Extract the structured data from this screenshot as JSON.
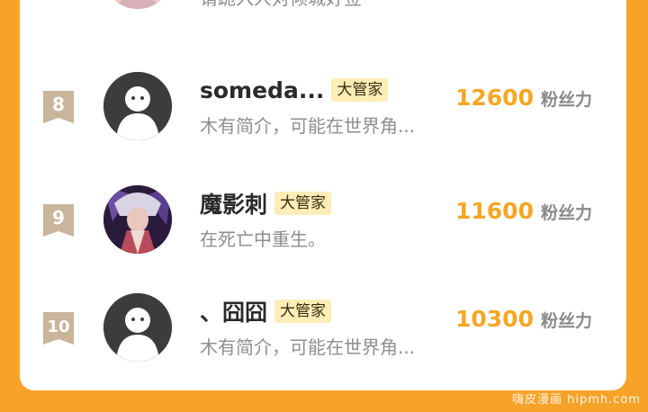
{
  "top_partial": {
    "intro": "请跪入人对倾城好签"
  },
  "rankings": [
    {
      "rank": "8",
      "name": "someda...",
      "badge": "大管家",
      "intro": "木有简介，可能在世界角...",
      "score": "12600",
      "unit": "粉丝力",
      "avatar": "default-avatar"
    },
    {
      "rank": "9",
      "name": "魔影刺",
      "badge": "大管家",
      "intro": "在死亡中重生。",
      "score": "11600",
      "unit": "粉丝力",
      "avatar": "anime-avatar"
    },
    {
      "rank": "10",
      "name": "、囧囧",
      "badge": "大管家",
      "intro": "木有简介，可能在世界角...",
      "score": "10300",
      "unit": "粉丝力",
      "avatar": "default-avatar"
    }
  ],
  "watermark": "嗨皮漫画 hipmh.com",
  "colors": {
    "background": "#f7a32a",
    "score": "#f5a623",
    "badge_bg": "#fdedb6",
    "rank_ribbon": "#c9b49c"
  }
}
